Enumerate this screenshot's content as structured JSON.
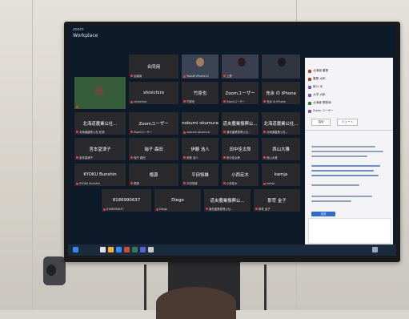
{
  "app": {
    "logo_top": "zoom",
    "logo_bottom": "Workplace"
  },
  "tiles": [
    {
      "main": "",
      "sub": "",
      "kind": "video-landscape"
    },
    {
      "main": "合同用",
      "sub": "会議用",
      "kind": "name"
    },
    {
      "main": "",
      "sub": "TakaW iPhone12",
      "kind": "video-person"
    },
    {
      "main": "",
      "sub": "上野",
      "kind": "video-person"
    },
    {
      "main": "",
      "sub": "",
      "kind": "video-person"
    },
    {
      "main": "",
      "sub": "",
      "kind": "video-person"
    },
    {
      "main": "shinichiro",
      "sub": "shinichiro",
      "kind": "name"
    },
    {
      "main": "竹原也",
      "sub": "竹原也",
      "kind": "name"
    },
    {
      "main": "Zoomユーザー",
      "sub": "Zoomユーザー",
      "kind": "name"
    },
    {
      "main": "充余 の iPhone",
      "sub": "充余 の iPhone",
      "kind": "name"
    },
    {
      "main": "北海道農業公社...",
      "sub": "北海道農業公社 松原",
      "kind": "name"
    },
    {
      "main": "Zoomユーザー",
      "sub": "Zoomユーザー",
      "kind": "name"
    },
    {
      "main": "nobumi okumura",
      "sub": "nobumi okumura",
      "kind": "name"
    },
    {
      "main": "道央農業振興公...",
      "sub": "道央農業振興公社...",
      "kind": "name"
    },
    {
      "main": "北海道農業公社...",
      "sub": "北海道農業公社...",
      "kind": "name"
    },
    {
      "main": "宮本望津子",
      "sub": "宮本望津子",
      "kind": "name"
    },
    {
      "main": "瑞子 森田",
      "sub": "瑞子 森田",
      "kind": "name"
    },
    {
      "main": "伊藤 浩人",
      "sub": "伊藤 浩人",
      "kind": "name"
    },
    {
      "main": "田中佳太郎",
      "sub": "田中佳太郎",
      "kind": "name"
    },
    {
      "main": "西山大雅",
      "sub": "西山大雅",
      "kind": "name"
    },
    {
      "main": "KYOKU Bunshin",
      "sub": "KYOKU Bunshin",
      "kind": "name"
    },
    {
      "main": "根源",
      "sub": "根源",
      "kind": "name"
    },
    {
      "main": "平田恒雄",
      "sub": "平田恒雄",
      "kind": "name"
    },
    {
      "main": "小西宏木",
      "sub": "小西宏木",
      "kind": "name"
    },
    {
      "main": "kamja",
      "sub": "kamja",
      "kind": "name"
    },
    {
      "main": "8186990637",
      "sub": "8186990637",
      "kind": "name"
    },
    {
      "main": "Diego",
      "sub": "Diego",
      "kind": "name"
    },
    {
      "main": "道央農業振興公...",
      "sub": "道央農業振興公社...",
      "kind": "name"
    },
    {
      "main": "那苛 金子",
      "sub": "那苛 金子",
      "kind": "name"
    }
  ],
  "participants_panel": {
    "rows": [
      {
        "label": "北海道 農業",
        "color": "#c0392b"
      },
      {
        "label": "農業 大和",
        "color": "#c0392b"
      },
      {
        "label": "新川 米",
        "color": "#7d4fc4"
      },
      {
        "label": "大学 大和",
        "color": "#7d4fc4"
      },
      {
        "label": "北海道 開発局",
        "color": "#2e7d32"
      },
      {
        "label": "Zoom ユーザー",
        "color": "#7d4fc4"
      }
    ],
    "invite_label": "招待",
    "mute_label": "ミュート"
  },
  "chat": {
    "send_to": "全員",
    "input_placeholder": ""
  }
}
